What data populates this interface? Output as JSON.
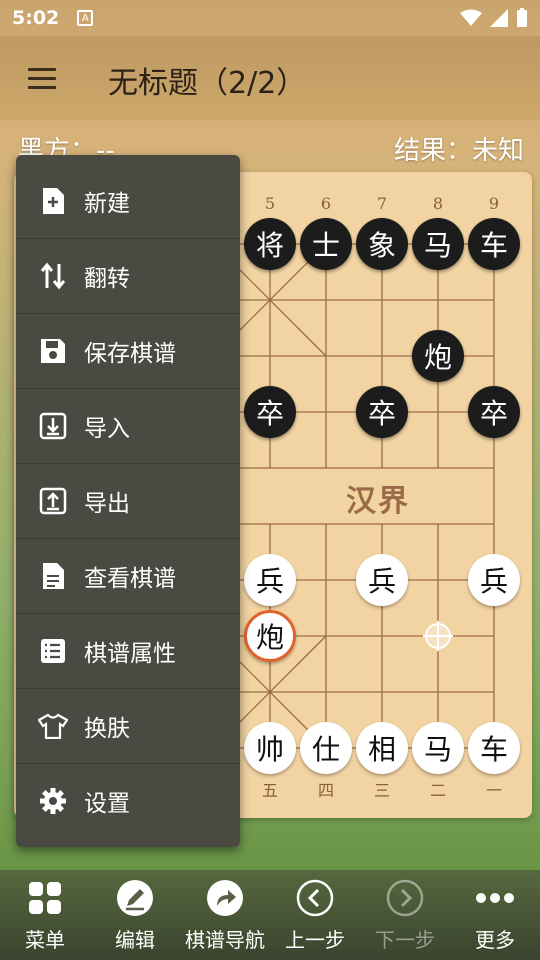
{
  "status_bar": {
    "time": "5:02",
    "notif_letter": "A"
  },
  "app_bar": {
    "title": "无标题（2/2）"
  },
  "info": {
    "black_side": "黑方：--",
    "result": "结果：未知"
  },
  "board": {
    "col_numbers_top": [
      "5",
      "6",
      "7",
      "8",
      "9"
    ],
    "col_numbers_bottom": [
      "五",
      "四",
      "三",
      "二",
      "一"
    ],
    "river_text": "汉界"
  },
  "pieces": [
    {
      "name": "black-general",
      "char": "将",
      "side": "black",
      "col": 4,
      "row": 0
    },
    {
      "name": "black-advisor",
      "char": "士",
      "side": "black",
      "col": 5,
      "row": 0
    },
    {
      "name": "black-elephant",
      "char": "象",
      "side": "black",
      "col": 6,
      "row": 0
    },
    {
      "name": "black-horse",
      "char": "马",
      "side": "black",
      "col": 7,
      "row": 0
    },
    {
      "name": "black-chariot",
      "char": "车",
      "side": "black",
      "col": 8,
      "row": 0
    },
    {
      "name": "black-cannon",
      "char": "炮",
      "side": "black",
      "col": 7,
      "row": 2
    },
    {
      "name": "black-soldier-5",
      "char": "卒",
      "side": "black",
      "col": 4,
      "row": 3
    },
    {
      "name": "black-soldier-7",
      "char": "卒",
      "side": "black",
      "col": 6,
      "row": 3
    },
    {
      "name": "black-soldier-9",
      "char": "卒",
      "side": "black",
      "col": 8,
      "row": 3
    },
    {
      "name": "red-soldier-5",
      "char": "兵",
      "side": "red",
      "col": 4,
      "row": 6
    },
    {
      "name": "red-soldier-3",
      "char": "兵",
      "side": "red",
      "col": 6,
      "row": 6
    },
    {
      "name": "red-soldier-1",
      "char": "兵",
      "side": "red",
      "col": 8,
      "row": 6
    },
    {
      "name": "red-cannon",
      "char": "炮",
      "side": "red",
      "col": 4,
      "row": 7,
      "selected": true
    },
    {
      "name": "red-general",
      "char": "帅",
      "side": "red",
      "col": 4,
      "row": 9
    },
    {
      "name": "red-advisor",
      "char": "仕",
      "side": "red",
      "col": 5,
      "row": 9
    },
    {
      "name": "red-elephant",
      "char": "相",
      "side": "red",
      "col": 6,
      "row": 9
    },
    {
      "name": "red-horse",
      "char": "马",
      "side": "red",
      "col": 7,
      "row": 9
    },
    {
      "name": "red-chariot",
      "char": "车",
      "side": "red",
      "col": 8,
      "row": 9
    }
  ],
  "move_target": {
    "col": 7,
    "row": 7
  },
  "menu": {
    "items": [
      {
        "label": "新建",
        "icon": "new-file-icon"
      },
      {
        "label": "翻转",
        "icon": "flip-icon"
      },
      {
        "label": "保存棋谱",
        "icon": "save-icon"
      },
      {
        "label": "导入",
        "icon": "import-icon"
      },
      {
        "label": "导出",
        "icon": "export-icon"
      },
      {
        "label": "查看棋谱",
        "icon": "view-record-icon"
      },
      {
        "label": "棋谱属性",
        "icon": "properties-icon"
      },
      {
        "label": "换肤",
        "icon": "skin-icon"
      },
      {
        "label": "设置",
        "icon": "settings-icon"
      }
    ]
  },
  "bottom_nav": [
    {
      "label": "菜单",
      "icon": "grid-icon",
      "enabled": true
    },
    {
      "label": "编辑",
      "icon": "edit-icon",
      "enabled": true
    },
    {
      "label": "棋谱导航",
      "icon": "share-arrow-icon",
      "enabled": true
    },
    {
      "label": "上一步",
      "icon": "prev-icon",
      "enabled": true
    },
    {
      "label": "下一步",
      "icon": "next-icon",
      "enabled": false
    },
    {
      "label": "更多",
      "icon": "more-icon",
      "enabled": true
    }
  ]
}
